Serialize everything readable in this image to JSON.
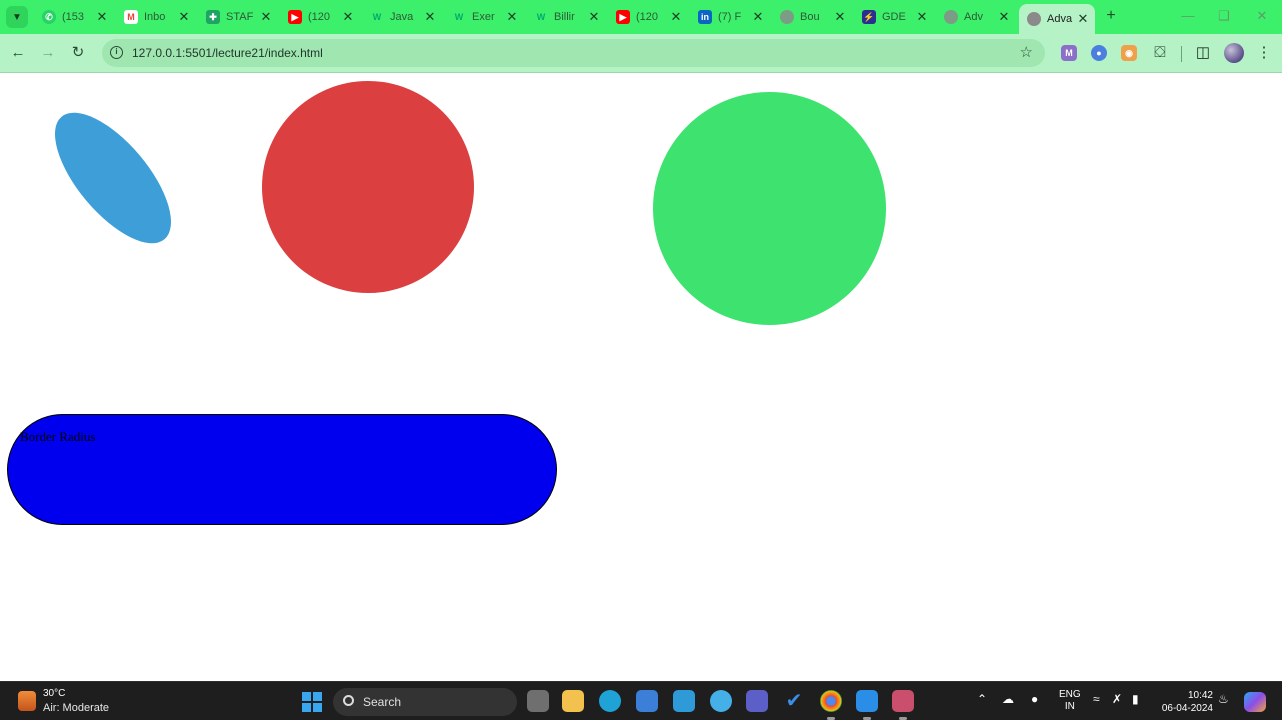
{
  "browser": {
    "tabs": [
      {
        "title": "(153",
        "icon": "whatsapp-icon",
        "color": "#25d366"
      },
      {
        "title": "Inbo",
        "icon": "gmail-icon",
        "color": "#ea4335"
      },
      {
        "title": "STAF",
        "icon": "sheets-icon",
        "color": "#1fa463"
      },
      {
        "title": "(120",
        "icon": "youtube-icon",
        "color": "#ff0000"
      },
      {
        "title": "Java",
        "icon": "w3schools-icon",
        "color": "#04aa6d"
      },
      {
        "title": "Exer",
        "icon": "w3schools-icon",
        "color": "#04aa6d"
      },
      {
        "title": "Billir",
        "icon": "w3schools-icon",
        "color": "#04aa6d"
      },
      {
        "title": "(120",
        "icon": "youtube-icon",
        "color": "#ff0000"
      },
      {
        "title": "(7) F",
        "icon": "linkedin-icon",
        "color": "#0a66c2"
      },
      {
        "title": "Bou",
        "icon": "globe-icon",
        "color": "#7c9c86"
      },
      {
        "title": "GDE",
        "icon": "bolt-icon",
        "color": "#2b2f8f"
      },
      {
        "title": "Adv",
        "icon": "globe-icon",
        "color": "#7c9c86"
      },
      {
        "title": "Adva",
        "icon": "globe-icon",
        "color": "#8a8a8a",
        "active": true
      }
    ],
    "url": "127.0.0.1:5501/lecture21/index.html"
  },
  "page": {
    "pill_text": "Border Radius"
  },
  "colors": {
    "blue_ellipse": "#3e9ed8",
    "red_circle": "#db3f3f",
    "green_circle": "#3ee26f",
    "pill_fill": "#0000ee"
  },
  "taskbar": {
    "weather_temp": "30°C",
    "weather_condition": "Air: Moderate",
    "search_label": "Search",
    "lang_line1": "ENG",
    "lang_line2": "IN",
    "time": "10:42",
    "date": "06-04-2024"
  }
}
